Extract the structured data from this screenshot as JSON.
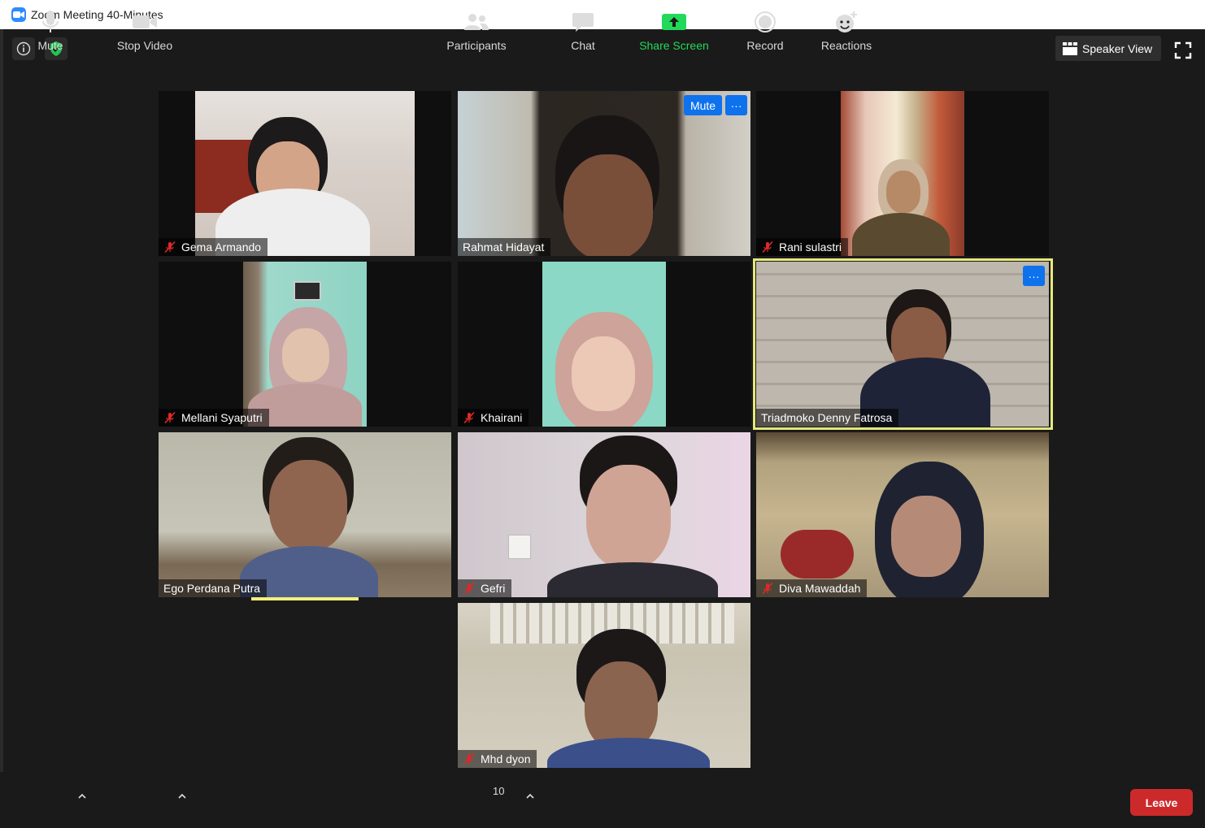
{
  "window": {
    "title": "Zoom Meeting 40-Minutes"
  },
  "top_bar": {
    "speaker_view_label": "Speaker View"
  },
  "tile_buttons": {
    "mute_label": "Mute",
    "more_label": "···"
  },
  "participants": [
    {
      "name": "Gema Armando",
      "muted": true
    },
    {
      "name": "Rahmat Hidayat",
      "muted": false
    },
    {
      "name": "Rani sulastri",
      "muted": true
    },
    {
      "name": "Mellani Syaputri",
      "muted": true
    },
    {
      "name": "Khairani",
      "muted": true
    },
    {
      "name": "Triadmoko Denny Fatrosa",
      "muted": false,
      "active_speaker": true
    },
    {
      "name": "Ego Perdana Putra",
      "muted": false,
      "speaking": true
    },
    {
      "name": "Gefri",
      "muted": true
    },
    {
      "name": "Diva Mawaddah",
      "muted": true
    },
    {
      "name": "Mhd dyon",
      "muted": true
    }
  ],
  "toolbar": {
    "mute": "Mute",
    "stop_video": "Stop Video",
    "participants": "Participants",
    "participants_count": "10",
    "chat": "Chat",
    "share_screen": "Share Screen",
    "record": "Record",
    "reactions": "Reactions",
    "leave": "Leave"
  },
  "colors": {
    "accent": "#2D8CFF",
    "share_green": "#23D959",
    "leave_red": "#CC2A2A",
    "muted_red": "#E02828",
    "active_border": "#E6E87A"
  }
}
